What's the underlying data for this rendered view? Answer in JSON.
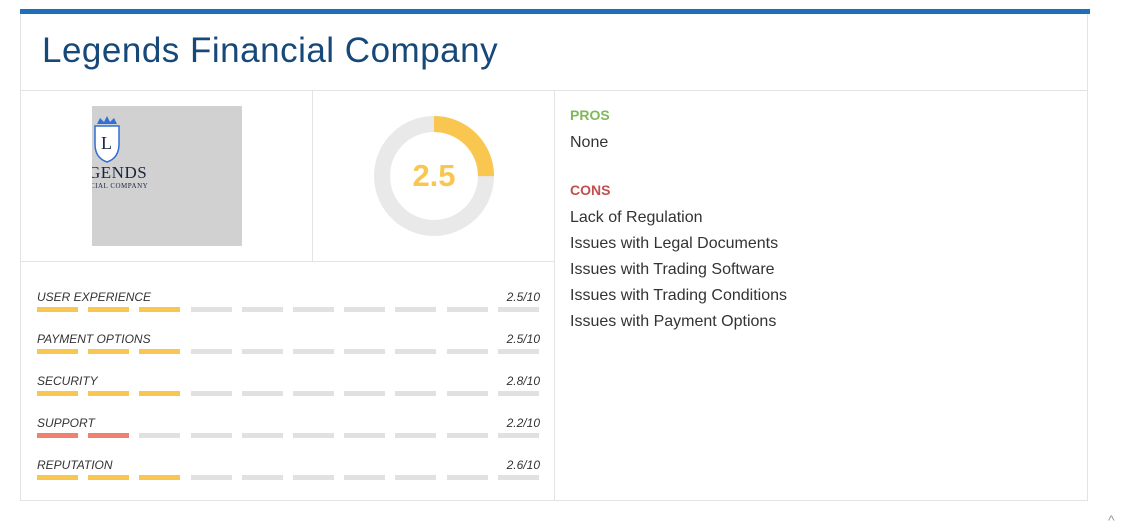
{
  "company": {
    "title": "Legends Financial Company"
  },
  "logo": {
    "text": "GENDS",
    "subtext": "CIAL COMPANY",
    "letter": "L"
  },
  "score": {
    "value": "2.5",
    "max": 10,
    "fraction": 0.25,
    "ring_color": "#f9c74f",
    "track_color": "#e9e9e9"
  },
  "ratings": [
    {
      "label": "USER EXPERIENCE",
      "value": "2.5/10",
      "filled_segments": 3,
      "color": "#f9c74f"
    },
    {
      "label": "PAYMENT OPTIONS",
      "value": "2.5/10",
      "filled_segments": 3,
      "color": "#f9c74f"
    },
    {
      "label": "SECURITY",
      "value": "2.8/10",
      "filled_segments": 3,
      "color": "#f9c74f"
    },
    {
      "label": "SUPPORT",
      "value": "2.2/10",
      "filled_segments": 2,
      "color": "#f08070"
    },
    {
      "label": "REPUTATION",
      "value": "2.6/10",
      "filled_segments": 3,
      "color": "#f9c74f"
    }
  ],
  "rating_segments_total": 10,
  "pros": {
    "title": "PROS",
    "items": [
      "None"
    ]
  },
  "cons": {
    "title": "CONS",
    "items": [
      "Lack of Regulation",
      "Issues with Legal Documents",
      "Issues with Trading Software",
      "Issues with Trading Conditions",
      "Issues with Payment Options"
    ]
  },
  "colors": {
    "accent_bar": "#1d6fb8",
    "title": "#16497a",
    "pros": "#7fb85a",
    "cons": "#c0504d"
  },
  "icons": {
    "scroll_up": "chevron-up-icon",
    "logo_crown": "crown-icon"
  },
  "scroll_up_glyph": "^"
}
